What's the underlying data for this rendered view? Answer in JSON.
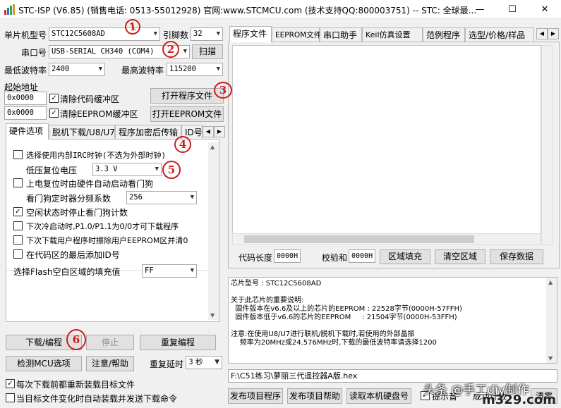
{
  "window": {
    "title": "STC-ISP (V6.85) (销售电话: 0513-55012928) 官网:www.STCMCU.com  (技术支持QQ:800003751)  -- STC: 全球最...",
    "min": "—",
    "max": "☐",
    "close": "✕"
  },
  "left": {
    "mcu_label": "单片机型号",
    "mcu_value": "STC12C5608AD",
    "pins_label": "引脚数",
    "pins_value": "32",
    "port_label": "串口号",
    "port_value": "USB-SERIAL CH340 (COM4)",
    "scan": "扫描",
    "minbaud_label": "最低波特率",
    "minbaud_value": "2400",
    "maxbaud_label": "最高波特率",
    "maxbaud_value": "115200",
    "start_label": "起始地址",
    "addr1": "0x0000",
    "clear_code": "清除代码缓冲区",
    "open_prog": "打开程序文件",
    "addr2": "0x0000",
    "clear_eeprom": "清除EEPROM缓冲区",
    "open_eeprom": "打开EEPROM文件",
    "tabs": [
      "硬件选项",
      "脱机下载/U8/U7",
      "程序加密后传输",
      "ID号"
    ],
    "options": {
      "irc": "选择使用内部IRC时钟(不选为外部时钟)",
      "lvr_label": "低压复位电压",
      "lvr_value": "3.3 V",
      "wdt": "上电复位时由硬件自动启动看门狗",
      "wdt_div_label": "看门狗定时器分频系数",
      "wdt_div_value": "256",
      "idle": "空闲状态时停止看门狗计数",
      "p10": "下次冷启动时,P1.0/P1.1为0/0才可下载程序",
      "eeprom": "下次下载用户程序时擦除用户EEPROM区并清0",
      "idnum": "在代码区的最后添加ID号",
      "fill_label": "选择Flash空白区域的填充值",
      "fill_value": "FF"
    },
    "download": "下载/编程",
    "stop": "停止",
    "reprog": "重复编程",
    "detect": "检测MCU选项",
    "help": "注意/帮助",
    "delay_label": "重复延时",
    "delay_value": "3 秒",
    "reload_each": "每次下载前都重新装载目标文件",
    "auto_reload": "当目标文件变化时自动装载并发送下载命令"
  },
  "right": {
    "tabs": [
      "程序文件",
      "EEPROM文件",
      "串口助手",
      "Keil仿真设置",
      "范例程序",
      "选型/价格/样品"
    ],
    "code_len_label": "代码长度",
    "code_len": "0000H",
    "checksum_label": "校验和",
    "checksum": "0000H",
    "fill": "区域填充",
    "clear": "清空区域",
    "save": "保存数据",
    "info": [
      "芯片型号 : STC12C5608AD",
      "",
      "关于此芯片的重要说明:",
      "  固件版本在v6.6及以上的芯片的EEPROM : 22528字节(0000H-57FFH)",
      "  固件版本低于v6.6的芯片的EEPROM     : 21504字节(0000H-53FFH)",
      "",
      "注意:在使用U8/U7进行联机/脱机下载时,若使用的外部晶振",
      "    频率为20MHz或24.576MHz时,下载的最低波特率请选择1200"
    ],
    "path": "F:\\C51练习\\萝丽三代遥控器A版.hex",
    "publish": "发布项目程序",
    "publish_help": "发布项目帮助",
    "read_serial": "读取本机硬盘号",
    "tip_check": "提示音",
    "tip_count": "成功计数",
    "tip_clear": "清零"
  },
  "annotations": [
    "1",
    "2",
    "3",
    "4",
    "5",
    "6"
  ],
  "watermark": "头条 @手工diy制作",
  "watermark2": "m329.com",
  "colors": {
    "anno": "#d01a1a",
    "window_bg": "#f0f0f0"
  }
}
